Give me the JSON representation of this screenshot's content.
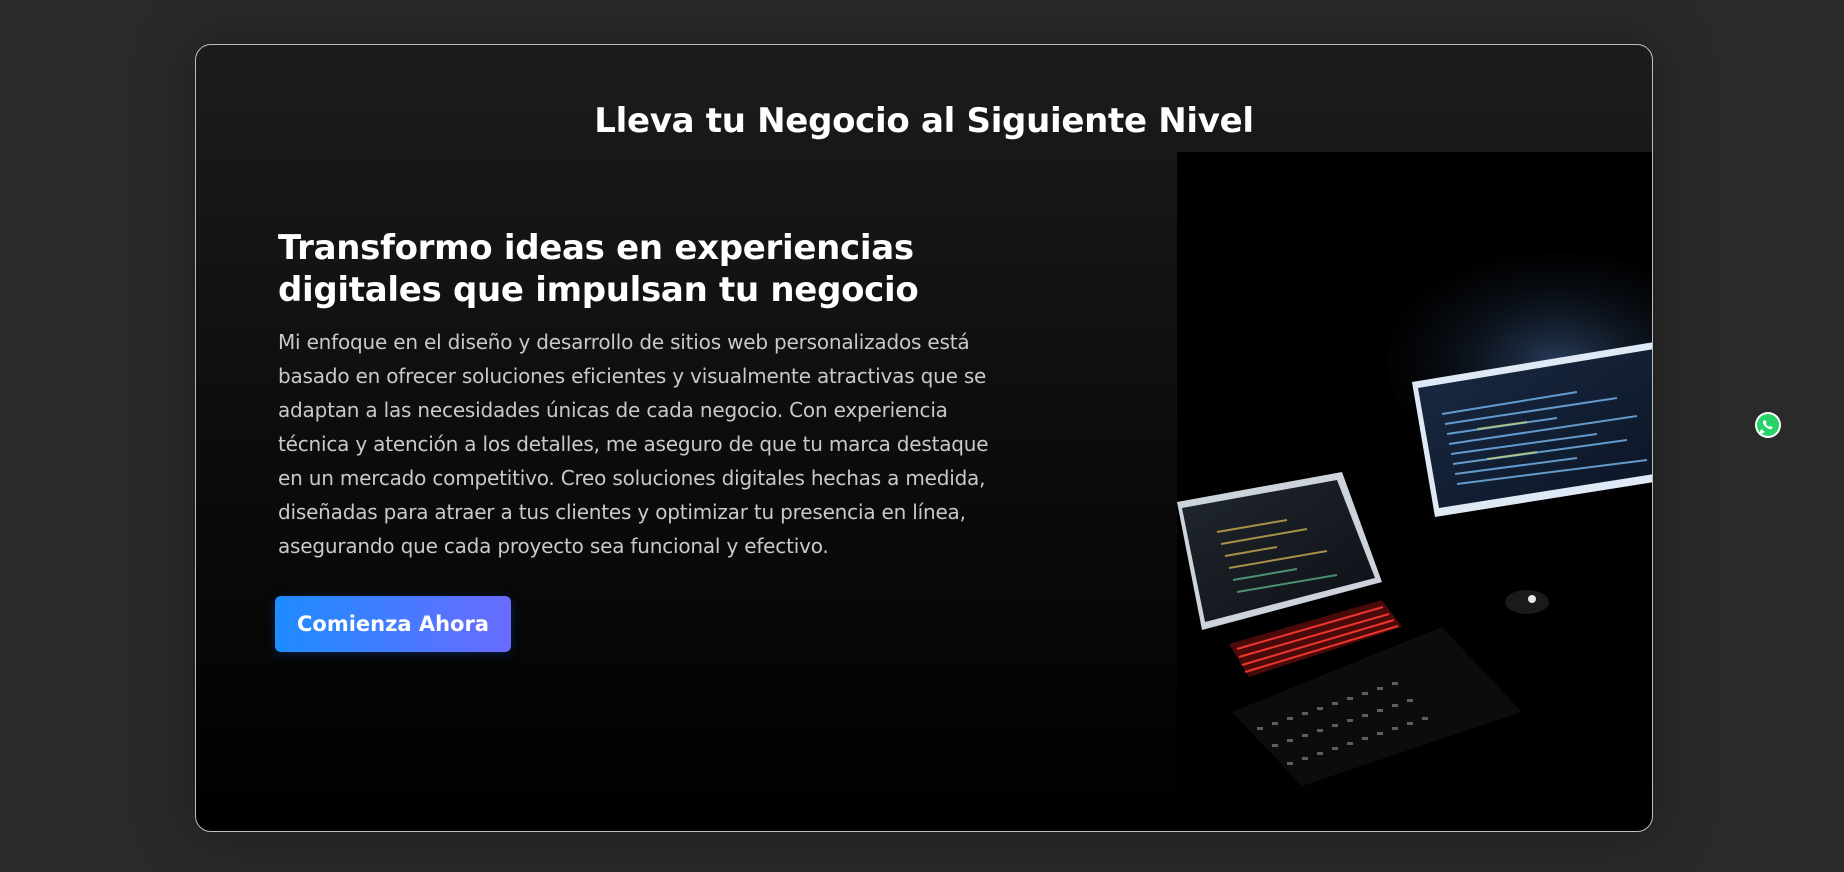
{
  "section": {
    "title": "Lleva tu Negocio al Siguiente Nivel"
  },
  "hero": {
    "headline": "Transformo ideas en experiencias digitales que impulsan tu negocio",
    "body": "Mi enfoque en el diseño y desarrollo de sitios web personalizados está basado en ofrecer soluciones eficientes y visualmente atractivas que se adaptan a las necesidades únicas de cada negocio. Con experiencia técnica y atención a los detalles, me aseguro de que tu marca destaque en un mercado competitivo. Creo soluciones digitales hechas a medida, diseñadas para atraer a tus clientes y optimizar tu presencia en línea, asegurando que cada proyecto sea funcional y efectivo.",
    "cta_label": "Comienza Ahora"
  },
  "icons": {
    "whatsapp": "whatsapp-icon"
  },
  "colors": {
    "page_bg": "#2a2a2a",
    "card_border": "#bdbdbd",
    "button_gradient_start": "#1d8cff",
    "button_gradient_end": "#6a6bff",
    "whatsapp_green": "#25D366"
  }
}
